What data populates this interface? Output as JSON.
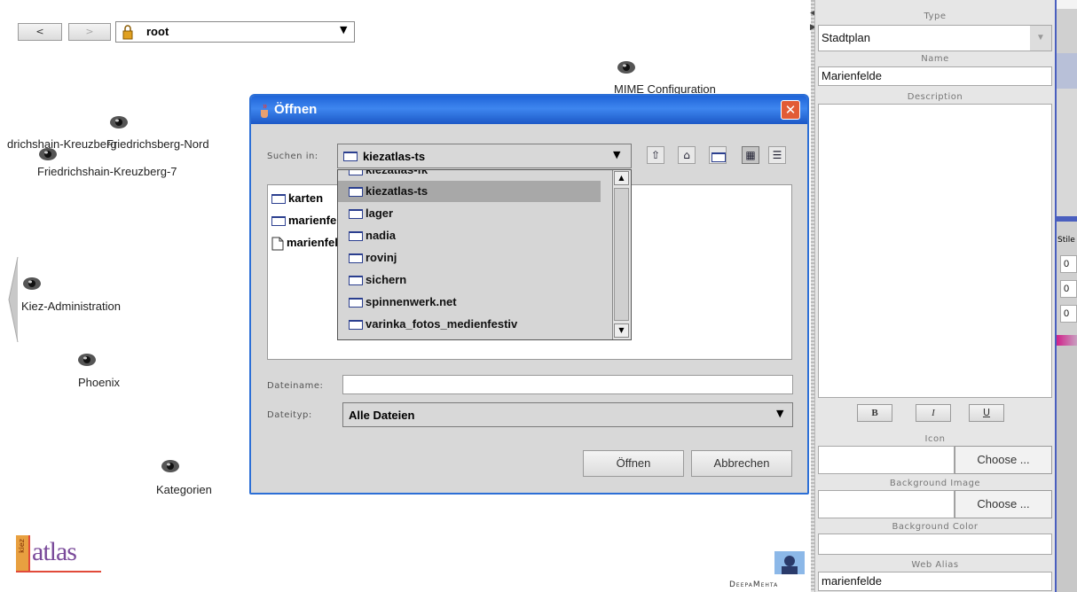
{
  "nav": {
    "back_label": "<",
    "forward_label": ">",
    "location_value": "root"
  },
  "canvas_nodes": {
    "mime": "MIME Configuration",
    "fk_nord": "drichshain-Kreuzberg-Friedrichsberg-Nord",
    "fk_nord_a": "drichshain-Kreuzberg",
    "fk_nord_b": "Friedrichsberg-Nord",
    "fk7": "Friedrichshain-Kreuzberg-7",
    "kiez_admin": "Kiez-Administration",
    "phoenix": "Phoenix",
    "kategorien": "Kategorien"
  },
  "logo": {
    "kiez": "kiez",
    "atlas": "atlas"
  },
  "brand": "DeepaMehta",
  "dialog": {
    "title": "Öffnen",
    "look_in_label": "Suchen in:",
    "look_in_value": "kiezatlas-ts",
    "files": [
      "karten",
      "marienfelde",
      "marienfelde"
    ],
    "dropdown_items": [
      "kiezatlas-fk",
      "kiezatlas-ts",
      "lager",
      "nadia",
      "rovinj",
      "sichern",
      "spinnenwerk.net",
      "varinka_fotos_medienfestiv"
    ],
    "selected_item": "kiezatlas-ts",
    "filename_label": "Dateiname:",
    "filename_value": "",
    "filetype_label": "Dateityp:",
    "filetype_value": "Alle Dateien",
    "open_button": "Öffnen",
    "cancel_button": "Abbrechen"
  },
  "panel": {
    "type_label": "Type",
    "type_value": "Stadtplan",
    "name_label": "Name",
    "name_value": "Marienfelde",
    "description_label": "Description",
    "bold": "B",
    "italic": "I",
    "underline": "U",
    "icon_label": "Icon",
    "choose": "Choose ...",
    "bg_image_label": "Background Image",
    "bg_color_label": "Background Color",
    "web_alias_label": "Web Alias",
    "web_alias_value": "marienfelde"
  },
  "farright": {
    "stile": "Stile",
    "values": [
      "0",
      "0",
      "0"
    ]
  }
}
